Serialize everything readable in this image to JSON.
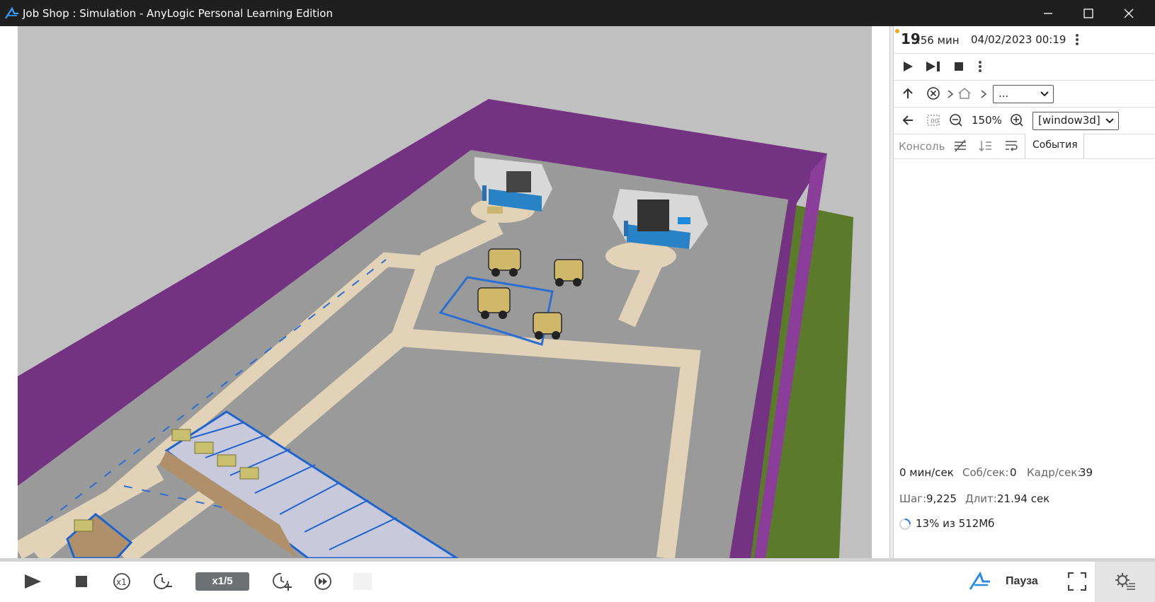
{
  "window": {
    "title": "Job Shop : Simulation - AnyLogic Personal Learning Edition"
  },
  "clock": {
    "time_big": "19",
    "time_small": ".56 мин",
    "date": "04/02/2023 00:19"
  },
  "navigation": {
    "dropdown_value": "...",
    "zoom_level": "150%",
    "view_select": "[window3d]"
  },
  "tabs": {
    "console": "Консоль",
    "events": "События"
  },
  "stats": {
    "speed": "0 мин/сек",
    "events_label": "Соб/сек:",
    "events_value": "0",
    "frames_label": "Кадр/сек:",
    "frames_value": "39",
    "step_label": "Шаг:",
    "step_value": "9,225",
    "duration_label": "Длит:",
    "duration_value": "21.94 сек",
    "memory": "13% из 512Мб"
  },
  "bottom": {
    "speed_badge": "x1/5",
    "pause_label": "Пауза"
  },
  "colors": {
    "wall": "#743282",
    "floor": "#999999",
    "grass": "#5a7a2a",
    "path": "#e3d3bb",
    "accent_blue": "#1d6fd6",
    "status_dot": "#f5a623"
  }
}
